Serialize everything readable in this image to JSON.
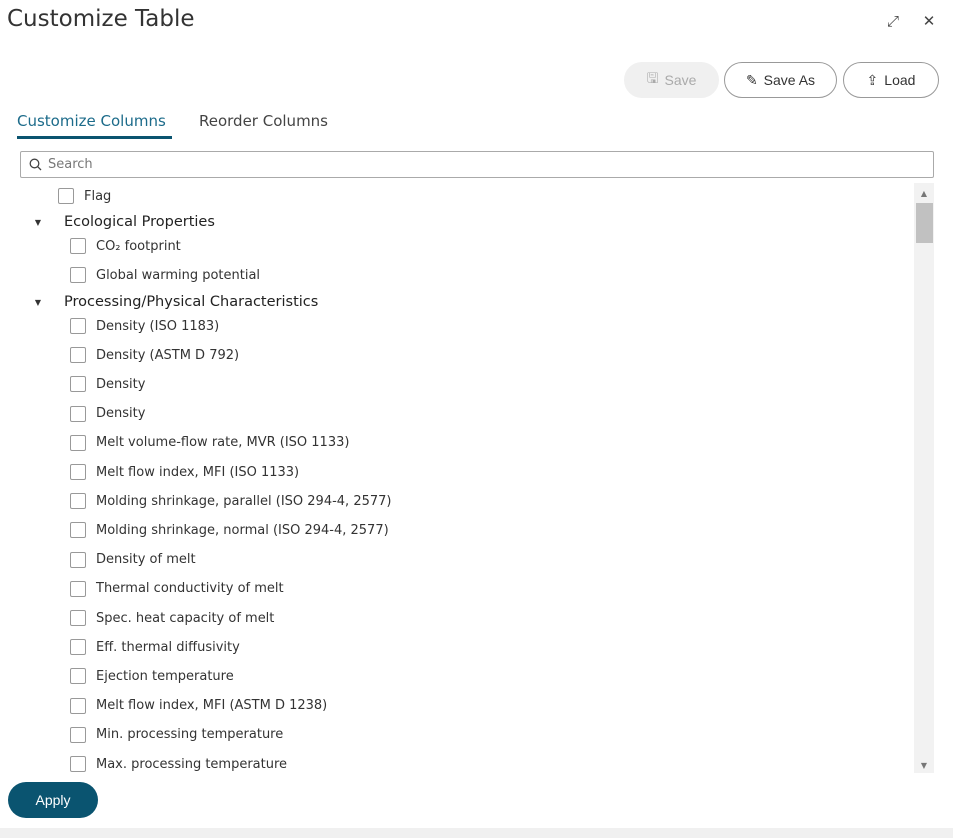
{
  "dialog": {
    "title": "Customize Table"
  },
  "toolbar": {
    "save_label": "Save",
    "save_as_label": "Save As",
    "load_label": "Load"
  },
  "tabs": [
    {
      "label": "Customize Columns",
      "active": true
    },
    {
      "label": "Reorder Columns",
      "active": false
    }
  ],
  "search": {
    "placeholder": "Search",
    "value": ""
  },
  "list": {
    "top_item": "Flag",
    "groups": [
      {
        "label": "Ecological Properties",
        "items": [
          "CO₂ footprint",
          "Global warming potential"
        ]
      },
      {
        "label": "Processing/Physical Characteristics",
        "items": [
          "Density (ISO 1183)",
          "Density (ASTM D 792)",
          "Density",
          "Density",
          "Melt volume-flow rate, MVR (ISO 1133)",
          "Melt flow index, MFI (ISO 1133)",
          "Molding shrinkage, parallel (ISO 294-4, 2577)",
          "Molding shrinkage, normal (ISO 294-4, 2577)",
          "Density of melt",
          "Thermal conductivity of melt",
          "Spec. heat capacity of melt",
          "Eff. thermal diffusivity",
          "Ejection temperature",
          "Melt flow index, MFI (ASTM D 1238)",
          "Min. processing temperature",
          "Max. processing temperature"
        ]
      }
    ]
  },
  "footer": {
    "apply_label": "Apply"
  },
  "colors": {
    "accent": "#0a5470",
    "tab_active": "#1c6b8a"
  }
}
